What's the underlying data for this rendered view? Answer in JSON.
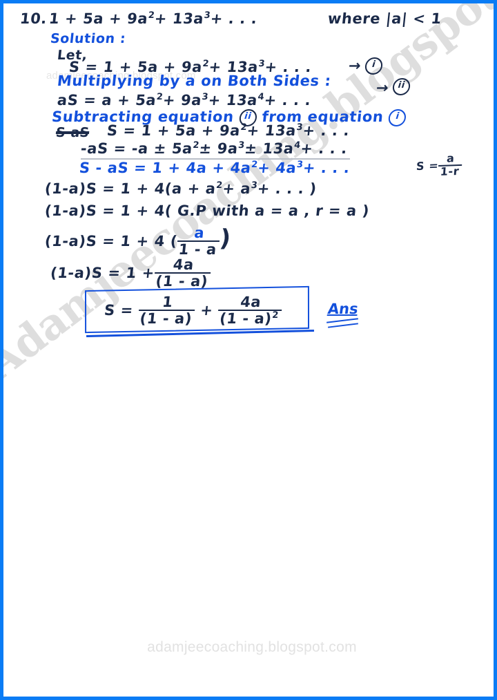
{
  "page": {
    "border_color": "#0a7cf5",
    "ink_dark": "#1b2a49",
    "ink_blue": "#1350dc",
    "background": "#ffffff"
  },
  "watermarks": {
    "diagonal": "Adamjeecoaching.blogspot.com",
    "footer": "adamjeecoaching.blogspot.com",
    "faint_inline": "adamjeecoaching.blogspot.com"
  },
  "problem": {
    "number": "10.",
    "series": "1 + 5a + 9a",
    "series_exp1": "2",
    "series_mid": "+ 13a",
    "series_exp2": "3",
    "series_tail": "+ . . .",
    "condition": "where |a| < 1"
  },
  "solution": {
    "heading": "Solution :",
    "let_label": "Let,",
    "eq1": {
      "lhs": "S =",
      "terms": "1 + 5a + 9a",
      "e1": "2",
      "mid": "+ 13a",
      "e2": "3",
      "tail": "+ . . .",
      "arrow": "→",
      "ref": "i"
    },
    "step_multiply": "Multiplying by a on Both Sides :",
    "eq2": {
      "lhs": "aS =",
      "terms": "a + 5a",
      "e1": "2",
      "mid": "+ 9a",
      "e2": "3",
      "mid2": "+ 13a",
      "e3": "4",
      "tail": "+ . . .",
      "arrow": "→",
      "ref": "ii"
    },
    "step_subtract_pre": "Subtracting equation",
    "step_subtract_ref1": "ii",
    "step_subtract_mid": "from equation",
    "step_subtract_ref2": "i",
    "crossed_out": "S-aS",
    "sub_line1": {
      "lhs": "S =",
      "terms": "1 + 5a + 9a",
      "e1": "2",
      "mid": "+ 13a",
      "e2": "3",
      "tail": "+ . . ."
    },
    "sub_line2": {
      "lhs": "-aS =",
      "terms": "-a ± 5a",
      "e1": "2",
      "mid": "± 9a",
      "e2": "3",
      "mid2": "± 13a",
      "e3": "4",
      "tail": "+ . . ."
    },
    "result_line": {
      "lhs": "S - aS =",
      "terms": "1 + 4a + 4a",
      "e1": "2",
      "mid": "+ 4a",
      "e2": "3",
      "tail": "+ . . ."
    },
    "gp_note": {
      "lhs": "S =",
      "num": "a",
      "den": "1-r"
    },
    "line_factor": {
      "lhs": "(1-a)S =",
      "rhs_pre": "1 + 4(a + a",
      "e1": "2",
      "rhs_mid": "+ a",
      "e2": "3",
      "rhs_tail": "+ . . . )"
    },
    "line_gp": {
      "lhs": "(1-a)S =",
      "rhs": "1 + 4( G.P with  a = a ,  r = a )"
    },
    "line_sum": {
      "lhs": "(1-a)S =",
      "rhs_pre": "1 + 4 (",
      "num": "a",
      "den": "1 - a",
      "rhs_post": ")"
    },
    "line_simplify": {
      "lhs": "(1-a)S =",
      "rhs_pre": "1 +",
      "num": "4a",
      "den": "(1 - a)"
    },
    "answer": {
      "lhs": "S =",
      "t1_num": "1",
      "t1_den": "(1 - a)",
      "plus": "+",
      "t2_num": "4a",
      "t2_den": "(1 - a)",
      "t2_den_exp": "2",
      "label": "Ans"
    }
  }
}
